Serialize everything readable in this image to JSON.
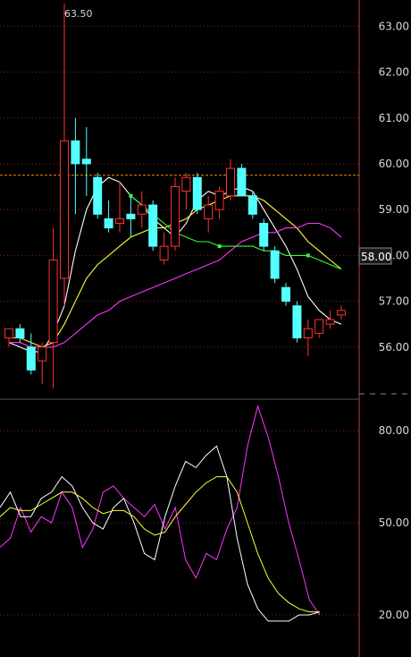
{
  "colors": {
    "background": "#000000",
    "grid": "#8b1c1c",
    "up": "#ff3030",
    "down": "#54ffff",
    "ma_white": "#ffffff",
    "ma_yellow": "#ffff33",
    "ma_magenta": "#ff33ff",
    "ma_green": "#33ff33",
    "dashed_ref": "#ff8c00",
    "axis_text": "#d8d8d8"
  },
  "chart_data": [
    {
      "type": "candlestick",
      "title": "",
      "price_ticks": [
        "63.00",
        "62.00",
        "61.00",
        "60.00",
        "59.00",
        "58.00",
        "57.00",
        "56.00"
      ],
      "ylim": [
        55.3,
        63.7
      ],
      "grid": true,
      "peak_label": "63.50",
      "current_price_tag": "58.00",
      "reference_line": 59.75,
      "candles": [
        {
          "o": 56.2,
          "h": 56.4,
          "l": 56.0,
          "c": 56.4
        },
        {
          "o": 56.4,
          "h": 56.5,
          "l": 56.1,
          "c": 56.2
        },
        {
          "o": 56.0,
          "h": 56.3,
          "l": 55.4,
          "c": 55.5
        },
        {
          "o": 55.7,
          "h": 56.1,
          "l": 55.2,
          "c": 56.0
        },
        {
          "o": 56.1,
          "h": 58.6,
          "l": 55.1,
          "c": 57.9
        },
        {
          "o": 57.5,
          "h": 63.5,
          "l": 56.9,
          "c": 60.5
        },
        {
          "o": 60.5,
          "h": 61.0,
          "l": 58.9,
          "c": 60.0
        },
        {
          "o": 60.1,
          "h": 60.8,
          "l": 59.3,
          "c": 60.0
        },
        {
          "o": 59.7,
          "h": 59.8,
          "l": 58.8,
          "c": 58.9
        },
        {
          "o": 58.8,
          "h": 59.2,
          "l": 58.5,
          "c": 58.6
        },
        {
          "o": 58.7,
          "h": 59.6,
          "l": 58.5,
          "c": 58.8
        },
        {
          "o": 58.9,
          "h": 59.3,
          "l": 58.4,
          "c": 58.8
        },
        {
          "o": 58.9,
          "h": 59.4,
          "l": 58.6,
          "c": 59.1
        },
        {
          "o": 59.1,
          "h": 59.2,
          "l": 58.1,
          "c": 58.2
        },
        {
          "o": 57.9,
          "h": 58.5,
          "l": 57.8,
          "c": 58.2
        },
        {
          "o": 58.2,
          "h": 59.7,
          "l": 58.1,
          "c": 59.5
        },
        {
          "o": 59.4,
          "h": 59.8,
          "l": 59.0,
          "c": 59.7
        },
        {
          "o": 59.7,
          "h": 59.8,
          "l": 58.9,
          "c": 59.0
        },
        {
          "o": 58.8,
          "h": 59.3,
          "l": 58.5,
          "c": 59.1
        },
        {
          "o": 59.0,
          "h": 59.5,
          "l": 58.8,
          "c": 59.4
        },
        {
          "o": 59.3,
          "h": 60.1,
          "l": 59.2,
          "c": 59.9
        },
        {
          "o": 59.9,
          "h": 60.0,
          "l": 59.3,
          "c": 59.3
        },
        {
          "o": 59.3,
          "h": 59.4,
          "l": 58.8,
          "c": 58.9
        },
        {
          "o": 58.7,
          "h": 58.8,
          "l": 58.1,
          "c": 58.2
        },
        {
          "o": 58.1,
          "h": 58.2,
          "l": 57.4,
          "c": 57.5
        },
        {
          "o": 57.3,
          "h": 57.4,
          "l": 56.9,
          "c": 57.0
        },
        {
          "o": 56.9,
          "h": 57.0,
          "l": 56.1,
          "c": 56.2
        },
        {
          "o": 56.2,
          "h": 56.6,
          "l": 55.8,
          "c": 56.4
        },
        {
          "o": 56.3,
          "h": 56.6,
          "l": 56.2,
          "c": 56.6
        },
        {
          "o": 56.5,
          "h": 56.8,
          "l": 56.4,
          "c": 56.6
        },
        {
          "o": 56.7,
          "h": 56.9,
          "l": 56.6,
          "c": 56.8
        }
      ],
      "ma_lines": [
        {
          "color_key": "ma_white",
          "values": [
            56.1,
            56.0,
            55.9,
            55.9,
            56.3,
            56.9,
            58.1,
            59.0,
            59.5,
            59.7,
            59.6,
            59.3,
            59.1,
            58.8,
            58.6,
            58.4,
            58.7,
            59.2,
            59.4,
            59.3,
            59.4,
            59.5,
            59.4,
            59.0,
            58.6,
            58.2,
            57.7,
            57.1,
            56.8,
            56.6,
            56.5
          ]
        },
        {
          "color_key": "ma_yellow",
          "values": [
            56.2,
            56.2,
            56.1,
            56.0,
            56.1,
            56.5,
            57.0,
            57.5,
            57.8,
            58.0,
            58.2,
            58.4,
            58.5,
            58.6,
            58.6,
            58.7,
            58.8,
            59.0,
            59.1,
            59.2,
            59.3,
            59.3,
            59.3,
            59.2,
            59.0,
            58.8,
            58.6,
            58.3,
            58.1,
            57.9,
            57.7
          ]
        },
        {
          "color_key": "ma_magenta",
          "values": [
            56.1,
            56.1,
            56.0,
            56.0,
            56.0,
            56.1,
            56.3,
            56.5,
            56.7,
            56.8,
            57.0,
            57.1,
            57.2,
            57.3,
            57.4,
            57.5,
            57.6,
            57.7,
            57.8,
            57.9,
            58.1,
            58.3,
            58.4,
            58.5,
            58.5,
            58.6,
            58.6,
            58.7,
            58.7,
            58.6,
            58.4
          ]
        },
        {
          "color_key": "ma_green",
          "start_index": 11,
          "values": [
            59.3,
            59.1,
            58.9,
            58.7,
            58.5,
            58.4,
            58.3,
            58.3,
            58.2,
            58.2,
            58.2,
            58.2,
            58.1,
            58.1,
            58.0,
            58.0,
            58.0,
            57.9,
            57.8,
            57.7
          ]
        }
      ]
    },
    {
      "type": "line",
      "title": "",
      "ticks": [
        "80.00",
        "50.00",
        "20.00"
      ],
      "ylim": [
        10,
        90
      ],
      "grid": true,
      "series": [
        {
          "color_key": "ma_magenta",
          "values": [
            42,
            45,
            55,
            47,
            52,
            50,
            60,
            55,
            42,
            48,
            60,
            62,
            58,
            55,
            52,
            56,
            48,
            55,
            38,
            32,
            40,
            38,
            48,
            55,
            75,
            88,
            78,
            65,
            50,
            38,
            25,
            20
          ]
        },
        {
          "color_key": "ma_white",
          "values": [
            55,
            60,
            52,
            52,
            58,
            60,
            65,
            62,
            55,
            50,
            48,
            55,
            58,
            50,
            40,
            38,
            52,
            62,
            70,
            68,
            72,
            75,
            65,
            45,
            30,
            22,
            18,
            18,
            18,
            20,
            20,
            21
          ]
        },
        {
          "color_key": "ma_yellow",
          "values": [
            52,
            55,
            54,
            54,
            56,
            58,
            60,
            60,
            58,
            55,
            53,
            54,
            54,
            52,
            48,
            46,
            47,
            52,
            56,
            60,
            63,
            65,
            65,
            60,
            50,
            40,
            32,
            27,
            24,
            22,
            21,
            21
          ]
        }
      ]
    }
  ]
}
